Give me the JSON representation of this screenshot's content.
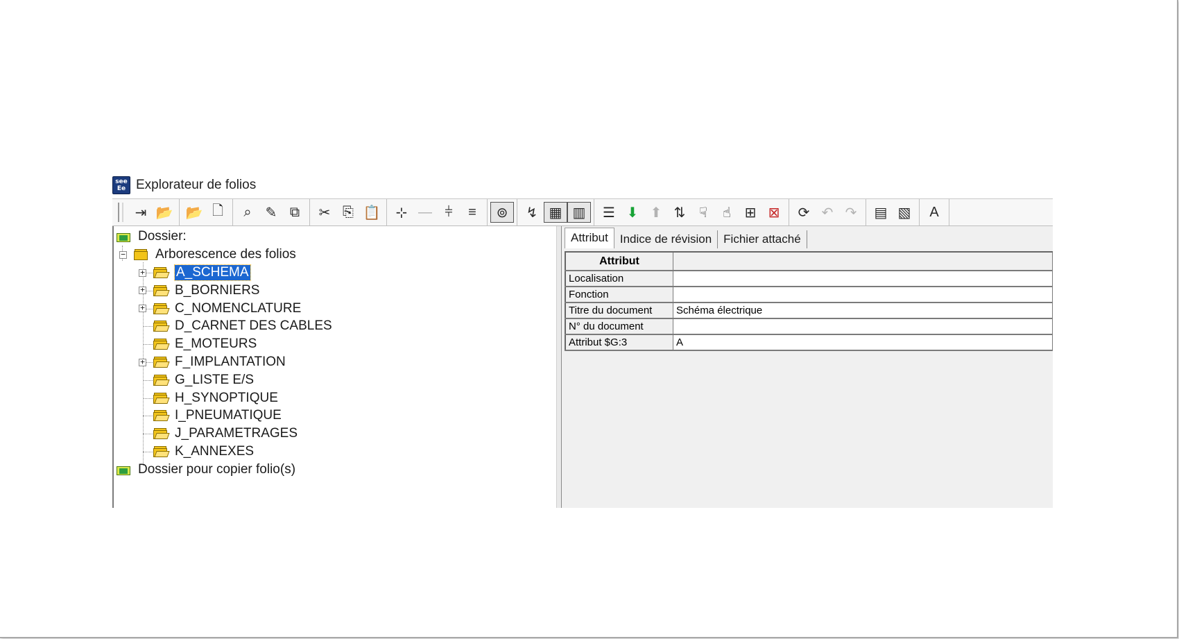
{
  "window": {
    "app_icon_lines": [
      "see",
      "Ee"
    ],
    "title": "Explorateur de folios"
  },
  "toolbar": {
    "groups": [
      [
        {
          "icon": "exit-icon"
        },
        {
          "icon": "open-folder-icon",
          "disabled": true
        }
      ],
      [
        {
          "icon": "folder-open-icon"
        },
        {
          "icon": "new-document-icon"
        }
      ],
      [
        {
          "icon": "search-icon"
        },
        {
          "icon": "edit-list-icon"
        },
        {
          "icon": "copy-folio-icon"
        }
      ],
      [
        {
          "icon": "cut-icon"
        },
        {
          "icon": "copy-icon"
        },
        {
          "icon": "paste-icon",
          "disabled": true
        }
      ],
      [
        {
          "icon": "insert-icon"
        },
        {
          "icon": "dash-icon",
          "disabled": true
        },
        {
          "icon": "split-icon"
        },
        {
          "icon": "lines-icon"
        }
      ],
      [
        {
          "icon": "preview-icon",
          "pressed": true
        }
      ],
      [
        {
          "icon": "chart-icon"
        },
        {
          "icon": "table-view-icon",
          "pressed": true
        },
        {
          "icon": "columns-view-icon",
          "pressed": true
        }
      ],
      [
        {
          "icon": "list-icon"
        },
        {
          "icon": "arrow-down-icon",
          "color": "green"
        },
        {
          "icon": "arrow-up-icon",
          "disabled": true
        },
        {
          "icon": "tree-sort-icon"
        },
        {
          "icon": "hand-down-icon"
        },
        {
          "icon": "hand-up-icon"
        },
        {
          "icon": "table-export-icon"
        },
        {
          "icon": "table-delete-icon",
          "color": "red"
        }
      ],
      [
        {
          "icon": "refresh-icon"
        },
        {
          "icon": "undo-icon",
          "disabled": true
        },
        {
          "icon": "redo-icon",
          "disabled": true
        }
      ],
      [
        {
          "icon": "folio-props-icon"
        },
        {
          "icon": "folio-compare-icon"
        }
      ],
      [
        {
          "icon": "text-size-icon"
        }
      ]
    ],
    "glyphs": {
      "exit-icon": "⇥",
      "open-folder-icon": "📂",
      "folder-open-icon": "📂",
      "new-document-icon": "🗋",
      "search-icon": "⌕",
      "edit-list-icon": "✎",
      "copy-folio-icon": "⧉",
      "cut-icon": "✂",
      "copy-icon": "⎘",
      "paste-icon": "📋",
      "insert-icon": "⊹",
      "dash-icon": "—",
      "split-icon": "⫩",
      "lines-icon": "≡",
      "preview-icon": "⊚",
      "chart-icon": "↯",
      "table-view-icon": "▦",
      "columns-view-icon": "▥",
      "list-icon": "☰",
      "arrow-down-icon": "⬇",
      "arrow-up-icon": "⬆",
      "tree-sort-icon": "⇅",
      "hand-down-icon": "☟",
      "hand-up-icon": "☝",
      "table-export-icon": "⊞",
      "table-delete-icon": "⊠",
      "refresh-icon": "⟳",
      "undo-icon": "↶",
      "redo-icon": "↷",
      "folio-props-icon": "▤",
      "folio-compare-icon": "▧",
      "text-size-icon": "A"
    }
  },
  "tree": {
    "root_label": "Dossier:",
    "branch_label": "Arborescence des folios",
    "items": [
      {
        "label": "A_SCHEMA",
        "expandable": true,
        "selected": true
      },
      {
        "label": "B_BORNIERS",
        "expandable": true
      },
      {
        "label": "C_NOMENCLATURE",
        "expandable": true
      },
      {
        "label": "D_CARNET DES CABLES",
        "expandable": false
      },
      {
        "label": "E_MOTEURS",
        "expandable": false
      },
      {
        "label": "F_IMPLANTATION",
        "expandable": true
      },
      {
        "label": "G_LISTE E/S",
        "expandable": false
      },
      {
        "label": "H_SYNOPTIQUE",
        "expandable": false
      },
      {
        "label": "I_PNEUMATIQUE",
        "expandable": false
      },
      {
        "label": "J_PARAMETRAGES",
        "expandable": false
      },
      {
        "label": "K_ANNEXES",
        "expandable": false
      }
    ],
    "copy_folder_label": "Dossier pour copier folio(s)"
  },
  "details": {
    "tabs": [
      {
        "label": "Attribut",
        "active": true
      },
      {
        "label": "Indice de révision"
      },
      {
        "label": "Fichier attaché"
      }
    ],
    "table_header": "Attribut",
    "rows": [
      {
        "key": "Localisation",
        "value": ""
      },
      {
        "key": "Fonction",
        "value": ""
      },
      {
        "key": "Titre du document",
        "value": "Schéma électrique"
      },
      {
        "key": "N° du document",
        "value": ""
      },
      {
        "key": "Attribut $G:3",
        "value": "A"
      }
    ]
  }
}
